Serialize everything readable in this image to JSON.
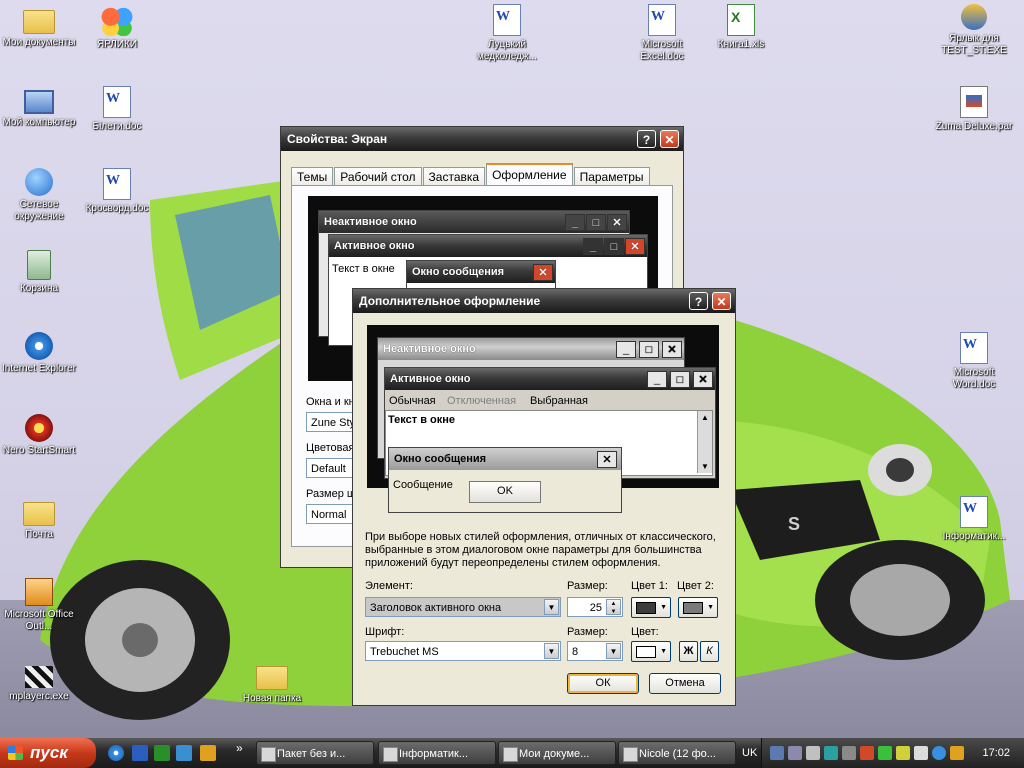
{
  "desktop": {
    "icons": [
      {
        "label": "Мои документы",
        "icon": "folder-documents-icon"
      },
      {
        "label": "ЯРЛИКИ",
        "icon": "butterfly-icon"
      },
      {
        "label": "Луцький медколедж...",
        "icon": "word-document-icon"
      },
      {
        "label": "Microsoft Excel.doc",
        "icon": "word-document-icon"
      },
      {
        "label": "Книга1.xls",
        "icon": "excel-document-icon"
      },
      {
        "label": "Ярлык для TEST_ST.EXE",
        "icon": "shortcut-app-icon"
      },
      {
        "label": "Мой компьютер",
        "icon": "my-computer-icon"
      },
      {
        "label": "Білети.doc",
        "icon": "word-document-icon"
      },
      {
        "label": "Zuma Deluxe.par",
        "icon": "zuma-file-icon"
      },
      {
        "label": "Сетевое окружение",
        "icon": "network-icon"
      },
      {
        "label": "Кросворд.doc",
        "icon": "word-document-icon"
      },
      {
        "label": "Корзина",
        "icon": "recycle-bin-icon"
      },
      {
        "label": "Internet Explorer",
        "icon": "internet-explorer-icon"
      },
      {
        "label": "Microsoft Word.doc",
        "icon": "word-document-icon"
      },
      {
        "label": "Nero StartSmart",
        "icon": "nero-icon"
      },
      {
        "label": "Почта",
        "icon": "folder-icon"
      },
      {
        "label": "Інформатик...",
        "icon": "word-document-icon"
      },
      {
        "label": "Microsoft Office Outl...",
        "icon": "outlook-icon"
      },
      {
        "label": "Новая папка",
        "icon": "folder-icon"
      },
      {
        "label": "mplayerc.exe",
        "icon": "media-player-icon"
      }
    ]
  },
  "display_properties": {
    "title": "Свойства: Экран",
    "help_glyph": "?",
    "close_glyph": "✕",
    "tabs": [
      "Темы",
      "Рабочий стол",
      "Заставка",
      "Оформление",
      "Параметры"
    ],
    "preview": {
      "inactive_title": "Неактивное окно",
      "active_title": "Активное окно",
      "window_text": "Текст в окне",
      "msgbox_title": "Окно сообщения"
    },
    "labels": {
      "windows_buttons": "Окна и кн",
      "color_scheme": "Цветовая",
      "font_size": "Размер ш"
    },
    "values": {
      "windows_buttons": "Zune Sty",
      "color_scheme": "Default",
      "font_size": "Normal"
    }
  },
  "advanced": {
    "title": "Дополнительное оформление",
    "help_glyph": "?",
    "close_glyph": "✕",
    "preview": {
      "inactive_title": "Неактивное окно",
      "active_title": "Активное окно",
      "menu": [
        "Обычная",
        "Отключенная",
        "Выбранная"
      ],
      "window_text": "Текст в окне",
      "msgbox_title": "Окно сообщения",
      "msgbox_text": "Сообщение",
      "msgbox_ok": "OK"
    },
    "info": "При выборе новых стилей оформления, отличных от классического, выбранные в этом диалоговом окне параметры для большинства приложений будут переопределены стилем оформления.",
    "labels": {
      "element": "Элемент:",
      "size": "Размер:",
      "color1": "Цвет 1:",
      "color2": "Цвет 2:",
      "font": "Шрифт:",
      "font_size": "Размер:",
      "font_color": "Цвет:"
    },
    "values": {
      "element": "Заголовок активного окна",
      "size": "25",
      "color1": "#3c3c3c",
      "color2": "#7a7a7a",
      "font": "Trebuchet MS",
      "font_size": "8",
      "font_color": "#ffffff",
      "bold": "Ж",
      "italic": "К"
    },
    "buttons": {
      "ok": "ОК",
      "cancel": "Отмена"
    }
  },
  "taskbar": {
    "start": "пуск",
    "more": "»",
    "tasks": [
      "Пакет без и...",
      "Інформатик...",
      "Мои докуме...",
      "Nicole (12 фо..."
    ],
    "lang": "UK",
    "clock": "17:02"
  }
}
